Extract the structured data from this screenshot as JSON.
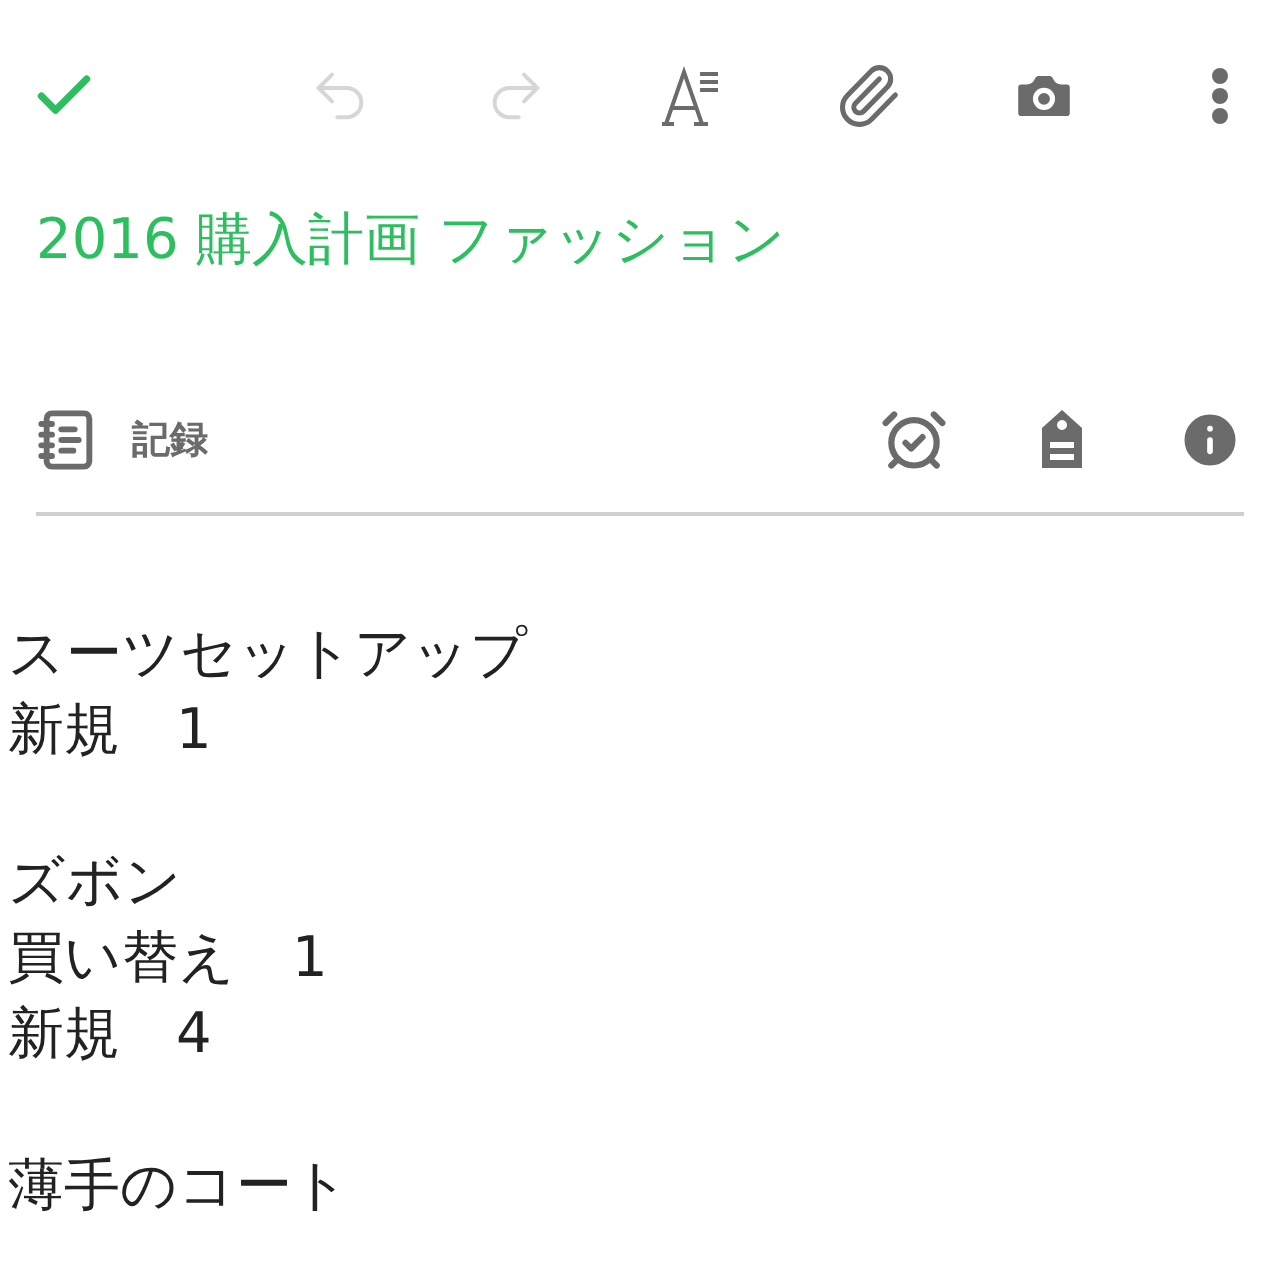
{
  "toolbar": [
    {
      "kind": "done",
      "disabled": false
    },
    {
      "kind": "undo",
      "disabled": true
    },
    {
      "kind": "redo",
      "disabled": true
    },
    {
      "kind": "format",
      "disabled": false
    },
    {
      "kind": "attach",
      "disabled": false
    },
    {
      "kind": "camera",
      "disabled": false
    },
    {
      "kind": "more",
      "disabled": false
    }
  ],
  "title": "2016 購入計画 ファッション",
  "notebook": {
    "name": "記録"
  },
  "body": [
    {
      "heading": "スーツセットアップ",
      "lines": [
        "新規　1"
      ]
    },
    {
      "heading": "ズボン",
      "lines": [
        "買い替え　1",
        "新規　4"
      ]
    },
    {
      "heading": "薄手のコート"
    }
  ]
}
